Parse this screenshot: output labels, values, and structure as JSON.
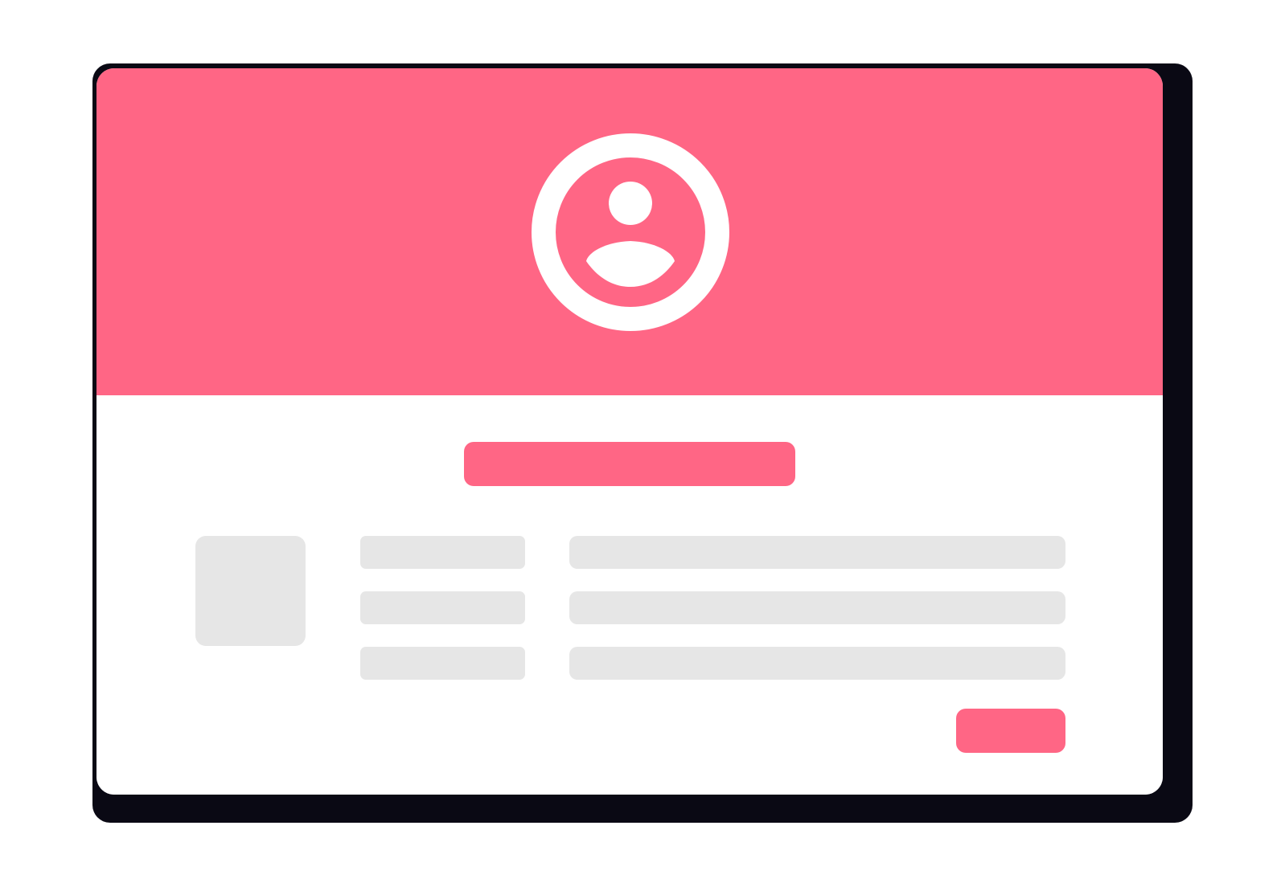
{
  "colors": {
    "accent": "#ff6685",
    "shadow": "#0a0914",
    "card": "#ffffff",
    "placeholder": "#e6e6e6",
    "icon": "#ffffff"
  },
  "header": {
    "avatar_icon": "user-circle-icon"
  },
  "profile": {
    "fields": [
      {
        "label": "",
        "value": ""
      },
      {
        "label": "",
        "value": ""
      },
      {
        "label": "",
        "value": ""
      }
    ]
  },
  "actions": {
    "primary_label": ""
  }
}
